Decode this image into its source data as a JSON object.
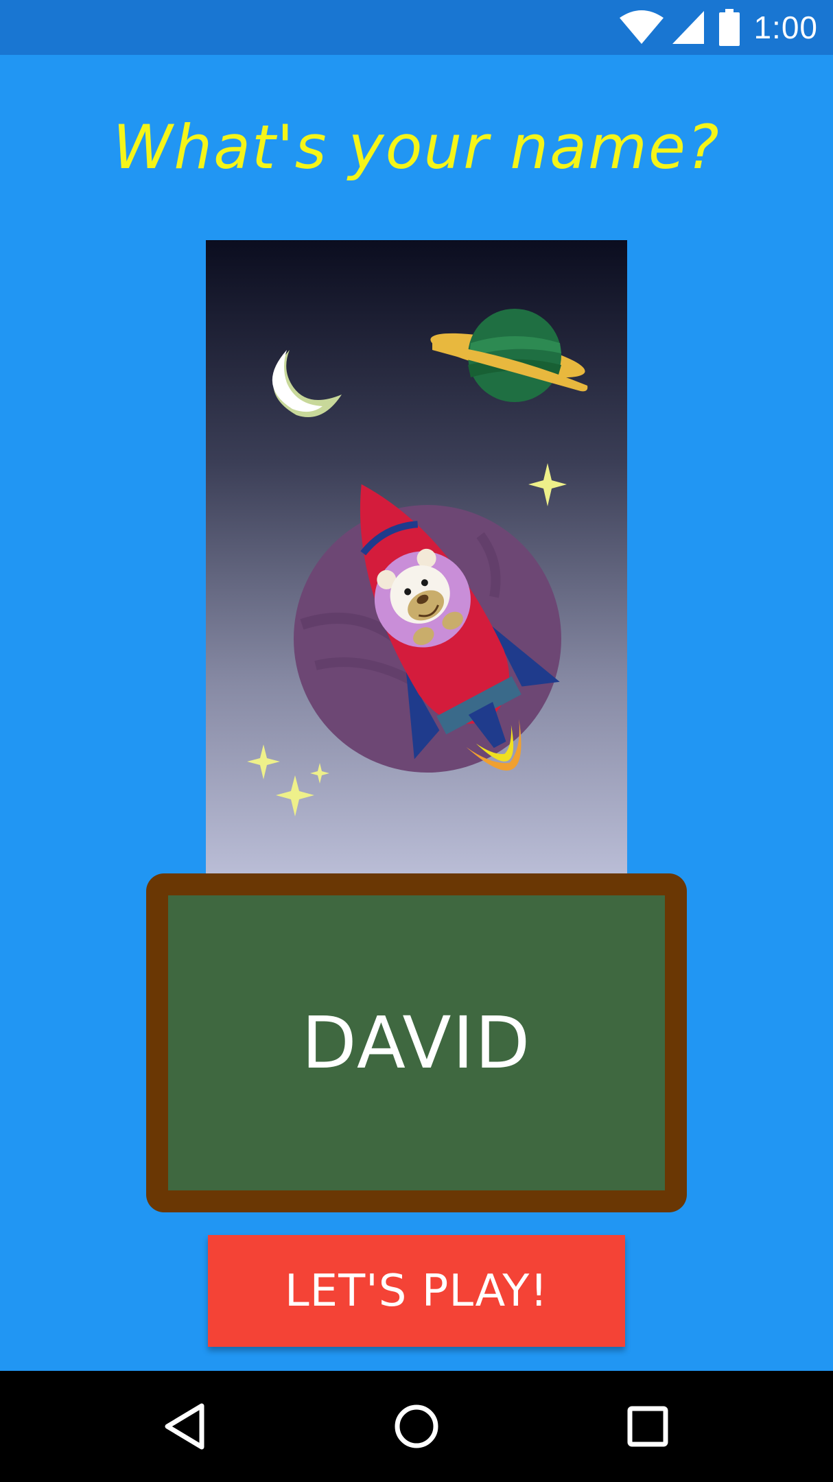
{
  "status_bar": {
    "time": "1:00",
    "icons": [
      "wifi-icon",
      "signal-icon",
      "battery-icon"
    ],
    "background": "#1976d2"
  },
  "header": {
    "title": "What's your name?",
    "title_color": "#f5f519"
  },
  "illustration": {
    "description_icon": "rocket-bear-space-illustration"
  },
  "name_board": {
    "value": "DAVID",
    "board_color": "#3f6840",
    "frame_color": "#6a3704"
  },
  "play_button": {
    "label": "LET'S PLAY!",
    "color": "#f44336"
  },
  "navigation": {
    "buttons": [
      "back-icon",
      "home-icon",
      "recents-icon"
    ]
  },
  "colors": {
    "background": "#2196f3"
  }
}
